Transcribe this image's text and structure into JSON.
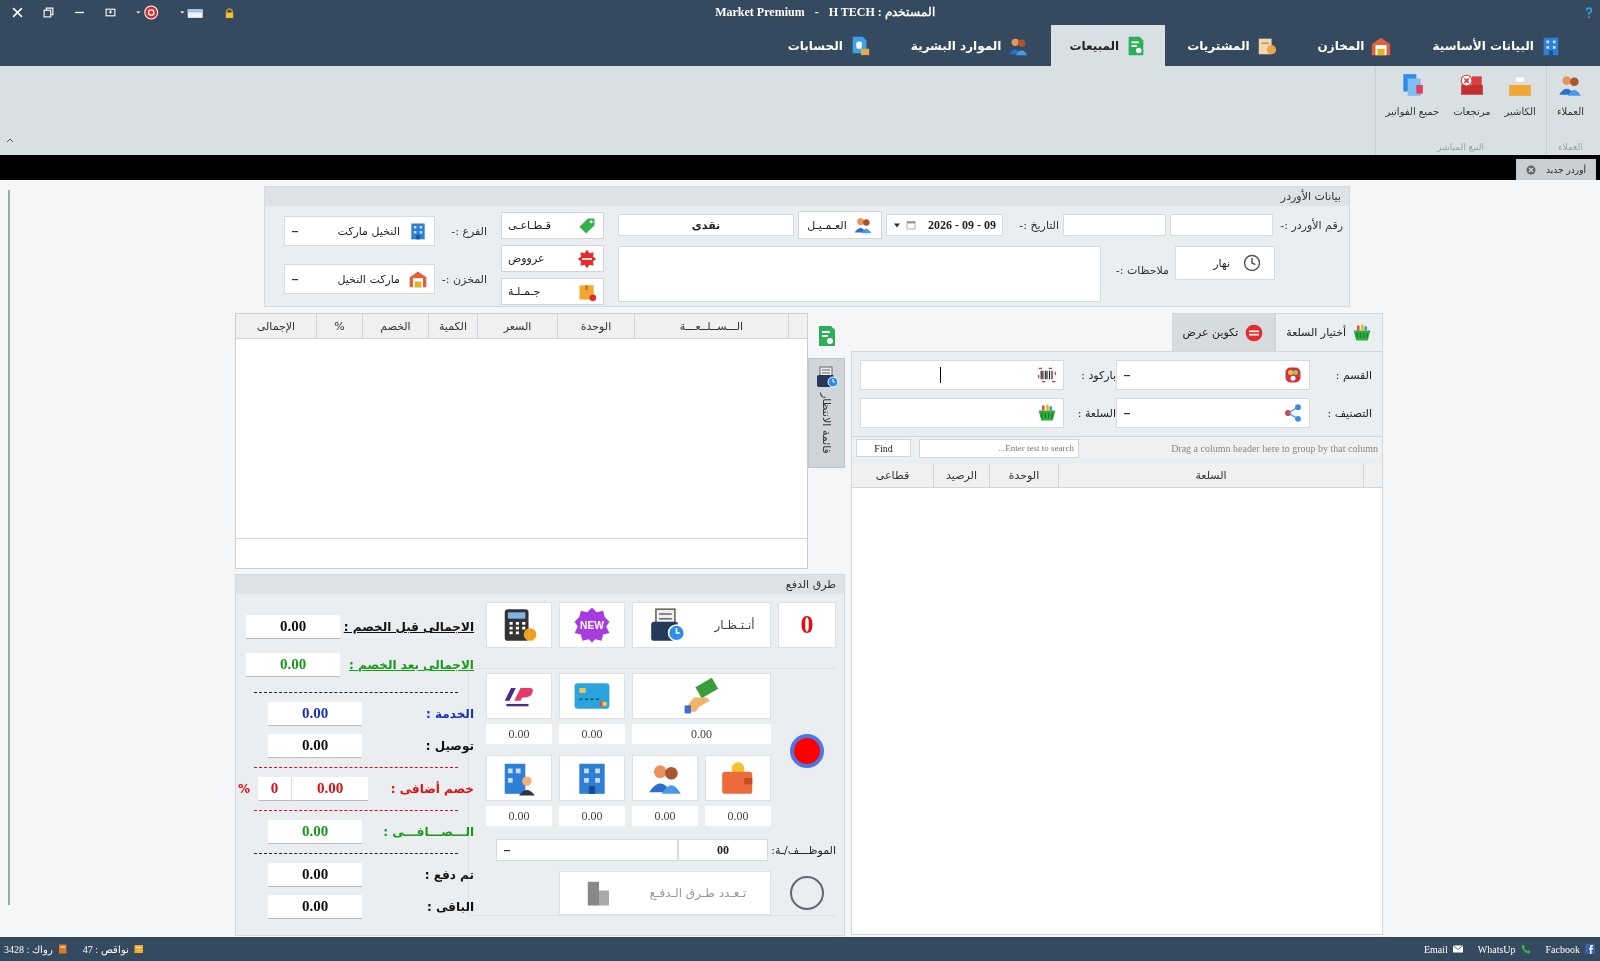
{
  "window": {
    "app_name": "Market Premium",
    "separator": "-",
    "user": "المستخدم : H TECH"
  },
  "tabs": [
    {
      "kind": "basic",
      "label": "البيانات الأساسية",
      "selected": false
    },
    {
      "kind": "stores",
      "label": "المخازن",
      "selected": false
    },
    {
      "kind": "purchases",
      "label": "المشتريات",
      "selected": false
    },
    {
      "kind": "sales",
      "label": "المبيعات",
      "selected": true
    },
    {
      "kind": "hr",
      "label": "الموارد البشرية",
      "selected": false
    },
    {
      "kind": "accounts",
      "label": "الحسابات",
      "selected": false
    }
  ],
  "ribbon": {
    "groups": [
      {
        "label": "العملاء",
        "items": [
          {
            "kind": "customers",
            "label": "العملاء"
          }
        ]
      },
      {
        "label": "البيع المباشر",
        "items": [
          {
            "kind": "cashier",
            "label": "الكاشير"
          },
          {
            "kind": "returns",
            "label": "مرتجعات"
          },
          {
            "kind": "invoices",
            "label": "جميع الفواتير"
          }
        ]
      }
    ]
  },
  "document_tabs": [
    {
      "label": "أوردر جديد",
      "selected": true
    }
  ],
  "order": {
    "title": "بيانات الأوردر",
    "order_number_label": "رقم الأوردر :-",
    "date_label": "التاريخ :-",
    "date": "2026 - 09 - 09",
    "customer_button": "العـمـيـل",
    "customer": "نقدى",
    "notes_label": "ملاحظات :-",
    "shift": "نهار",
    "price_types": [
      {
        "kind": "retail",
        "label": "قـطـاعـى"
      },
      {
        "kind": "offers",
        "label": "عرووض"
      },
      {
        "kind": "wholesale",
        "label": "جـمـلـة"
      }
    ],
    "branch_label": "الفرع :-",
    "branch": "النخيل ماركت",
    "store_label": "المخزن :-",
    "store": "ماركت النخيل"
  },
  "items_grid": {
    "columns": [
      "الـــســلــعـــة",
      "الوحدة",
      "السعر",
      "الكمية",
      "الخصم",
      "%",
      "الإجمالى"
    ]
  },
  "waiting_list": {
    "label": "قائمة الانتظار"
  },
  "picker": {
    "tabs": [
      {
        "kind": "choose",
        "label": "أختيار السلعة",
        "selected": true
      },
      {
        "kind": "offer",
        "label": "تكوين عرض",
        "selected": false
      }
    ],
    "fields": [
      {
        "kind": "section",
        "label": "القسم :"
      },
      {
        "kind": "barcode",
        "label": "باركود :"
      },
      {
        "kind": "category",
        "label": "التصنيف :"
      },
      {
        "kind": "product",
        "label": "السلعة :"
      }
    ],
    "group_hint": "Drag a column header here to group by that column",
    "search_placeholder": "Enter test to search...",
    "find_button": "Find",
    "columns": [
      "السلعة",
      "الوحدة",
      "الرصيد",
      "قطاعى"
    ]
  },
  "payment": {
    "title": "طرق الدفع",
    "count": "0",
    "wait_button": "أنـتـظـار",
    "new_button": "NEW",
    "methods": [
      {
        "kind": "cash",
        "amount": "0.00"
      },
      {
        "kind": "card",
        "amount": "0.00"
      },
      {
        "kind": "instapay",
        "amount": "0.00"
      },
      {
        "kind": "wallet",
        "amount": "0.00"
      },
      {
        "kind": "customer",
        "amount": "0.00"
      },
      {
        "kind": "company",
        "amount": "0.00"
      },
      {
        "kind": "company_agent",
        "amount": "0.00"
      }
    ],
    "radios": [
      {
        "selected": true
      },
      {
        "selected": false
      }
    ],
    "employee": {
      "label": "الموظـــف/ـة:",
      "code": "00"
    },
    "multi_button": {
      "label": "تـعـدد طـرق الـدفـع",
      "disabled": true
    },
    "totals": [
      {
        "kind": "total_before",
        "label": "الاجمالى قبل الخصم :",
        "value": "0.00"
      },
      {
        "kind": "total_after",
        "label": "الاجمالى بعد الخصم :",
        "value": "0.00"
      },
      {
        "kind": "service",
        "label": "الخدمة :",
        "value": "0.00"
      },
      {
        "kind": "delivery",
        "label": "توصيل :",
        "value": "0.00"
      },
      {
        "kind": "extra_discount",
        "label": "خصم أضافى :",
        "value": "0.00",
        "percent": "0",
        "percent_sign": "%"
      },
      {
        "kind": "net",
        "label": "الـــصـــافـــى :",
        "value": "0.00"
      },
      {
        "kind": "paid",
        "label": "تم دفع :",
        "value": "0.00"
      },
      {
        "kind": "remaining",
        "label": "الباقى :",
        "value": "0.00"
      }
    ]
  },
  "status_bar": {
    "left": [
      {
        "kind": "shortages",
        "text": "نواقص : 47"
      },
      {
        "kind": "stagnant",
        "text": "رواك : 3428"
      }
    ],
    "right": [
      {
        "kind": "facebook",
        "text": "Facbook"
      },
      {
        "kind": "whatsapp",
        "text": "WhatsUp"
      },
      {
        "kind": "email",
        "text": "Email"
      }
    ]
  }
}
